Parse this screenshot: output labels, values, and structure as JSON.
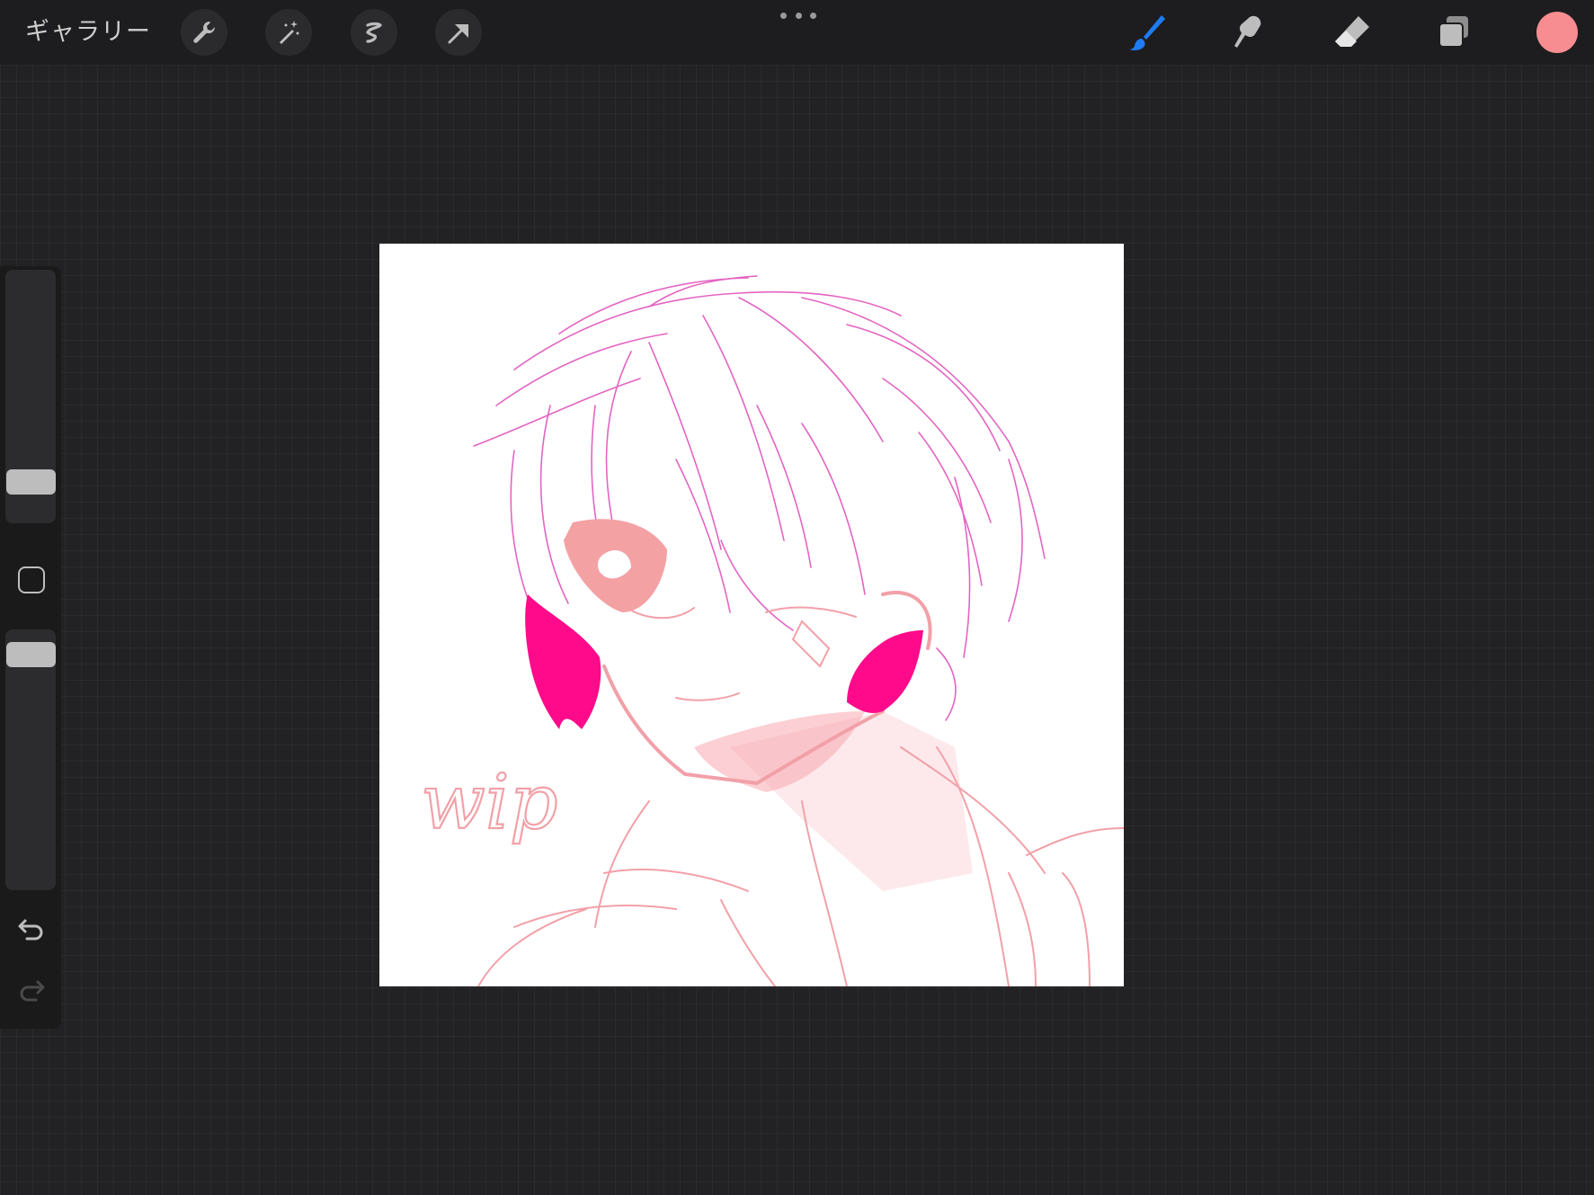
{
  "toolbar": {
    "gallery_label": "ギャラリー",
    "left_tools": [
      "wrench-icon",
      "magic-wand-icon",
      "selection-icon",
      "move-arrow-icon"
    ],
    "right_tools": [
      "brush-icon",
      "smudge-icon",
      "eraser-icon",
      "layers-icon"
    ],
    "active_tool": "brush-icon",
    "active_tool_color": "#1e7cf2",
    "current_color": "#f78d91"
  },
  "sidebar": {
    "brush_size_level": 0.15,
    "opacity_level": 1.0,
    "icons": [
      "modify-square-icon",
      "undo-icon",
      "redo-icon"
    ]
  },
  "canvas": {
    "background": "#ffffff",
    "handwritten_text": "wip",
    "stroke_colors": [
      "#e04ab8",
      "#f2a0a8",
      "#ff0a8a"
    ]
  }
}
